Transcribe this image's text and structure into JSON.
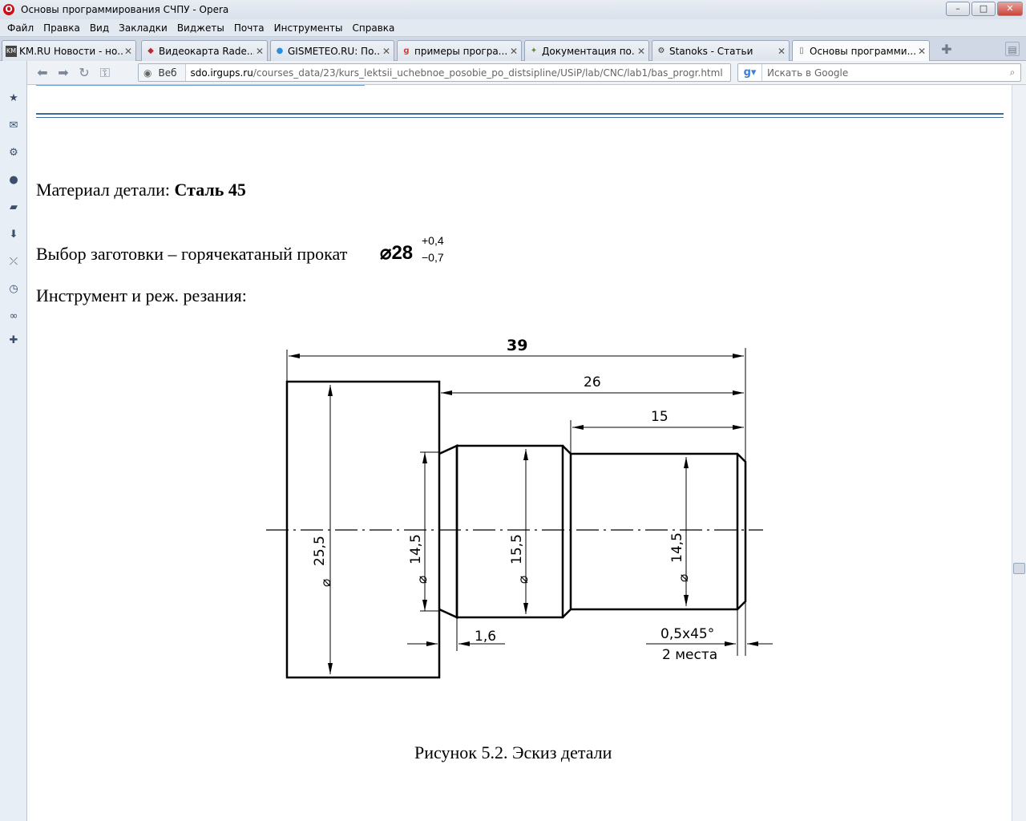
{
  "window": {
    "title": "Основы программирования СЧПУ - Opera",
    "controls": {
      "minimize": "–",
      "maximize": "□",
      "close": "✕"
    }
  },
  "menu": [
    "Файл",
    "Правка",
    "Вид",
    "Закладки",
    "Виджеты",
    "Почта",
    "Инструменты",
    "Справка"
  ],
  "tabs": [
    {
      "label": "KM.RU Новости - но...",
      "icon": "km-icon"
    },
    {
      "label": "Видеокарта Rade...",
      "icon": "radeon-icon"
    },
    {
      "label": "GISMETEO.RU: По...",
      "icon": "gismeteo-icon"
    },
    {
      "label": "примеры програ...",
      "icon": "google-icon"
    },
    {
      "label": "Документация по...",
      "icon": "docs-icon"
    },
    {
      "label": "Stanoks - Статьи",
      "icon": "stanoks-icon"
    },
    {
      "label": "Основы программи...",
      "icon": "page-icon",
      "active": true
    }
  ],
  "address": {
    "site_label": "Веб",
    "url_host": "sdo.irgups.ru",
    "url_path": "/courses_data/23/kurs_lektsii_uchebnoe_posobie_po_distsipline/USiP/lab/CNC/lab1/bas_progr.html"
  },
  "search": {
    "placeholder": "Искать в Google"
  },
  "sidebar_icons": [
    "bookmarks-icon",
    "mail-icon",
    "settings-icon",
    "contacts-icon",
    "notes-icon",
    "downloads-icon",
    "links-icon",
    "history-icon",
    "link-icon",
    "add-panel-icon"
  ],
  "page": {
    "material_label": "Материал детали: ",
    "material_value": "Сталь 45",
    "blank_label": "Выбор заготовки – горячекатаный прокат",
    "blank_dia": "⌀28",
    "blank_tol_upper": "+0,4",
    "blank_tol_lower": "−0,7",
    "tool_label": "Инструмент и реж. резания:",
    "caption": "Рисунок 5.2. Эскиз детали"
  },
  "drawing": {
    "dims": {
      "overall_length": "39",
      "length_26": "26",
      "length_15": "15",
      "dia_large": "25,5",
      "dia_neck": "14,5",
      "dia_mid": "15,5",
      "dia_end": "14,5",
      "dia_symbol": "⌀",
      "groove": "1,6",
      "chamfer": "0,5x45°",
      "chamfer_note": "2 места"
    }
  },
  "colors": {
    "rule": "#3d6c9c",
    "accent": "#cc0f16"
  }
}
